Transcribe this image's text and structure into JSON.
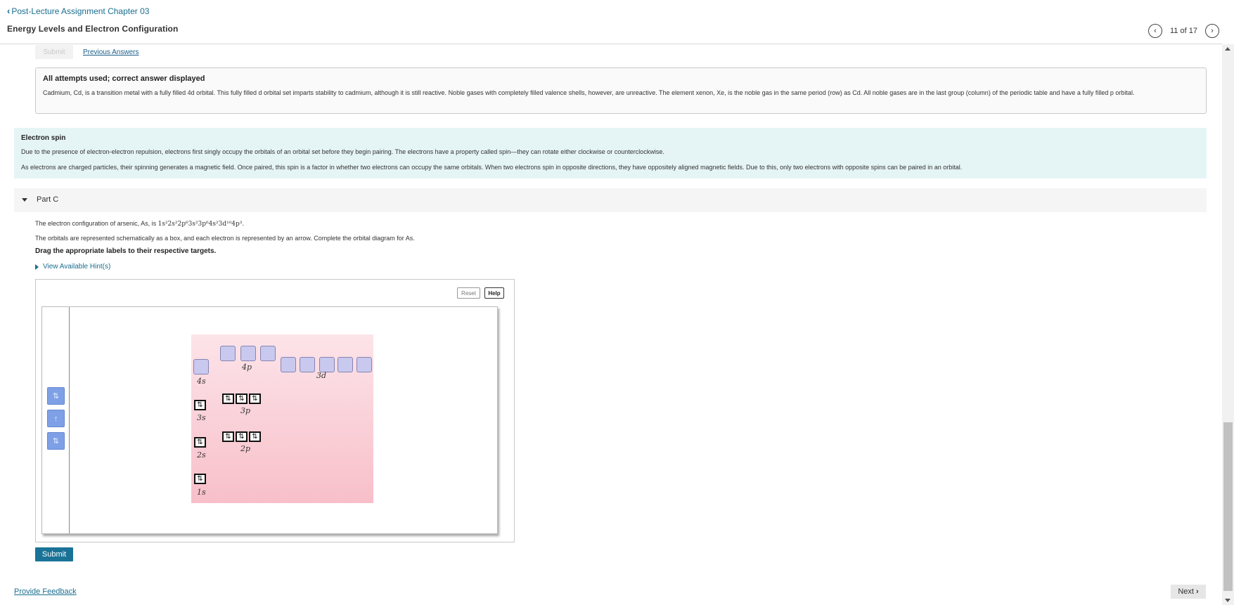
{
  "header": {
    "back_label": "Post-Lecture Assignment Chapter 03",
    "title": "Energy Levels and Electron Configuration",
    "pager": "11 of 17",
    "prev_glyph": "‹",
    "next_glyph": "›"
  },
  "previous_part": {
    "submit_label": "Submit",
    "previous_answers_label": "Previous Answers",
    "feedback_title": "All attempts used; correct answer displayed",
    "feedback_text": "Cadmium, Cd, is a transition metal with a fully filled 4d orbital. This fully filled d orbital set imparts stability to cadmium, although it is still reactive. Noble gases with completely filled valence shells, however, are unreactive. The element xenon, Xe, is the noble gas in the same period (row) as Cd. All noble gases are in the last group (column) of the periodic table and have a fully filled p orbital."
  },
  "electron_spin": {
    "title": "Electron spin",
    "paragraph1": "Due to the presence of electron-electron repulsion, electrons first singly occupy the orbitals of an orbital set before they begin pairing. The electrons have a property called spin—they can rotate either clockwise or counterclockwise.",
    "paragraph2": "As electrons are charged particles, their spinning generates a magnetic field. Once paired, this spin is a factor in whether two electrons can occupy the same orbitals. When two electrons spin in opposite directions, they have oppositely aligned magnetic fields. Due to this, only two electrons with opposite spins can be paired in an orbital."
  },
  "part_c": {
    "label": "Part C",
    "config_prefix": "The electron configuration of arsenic, As, is ",
    "config": "1s²2s²2p⁶3s²3p⁶4s²3d¹⁰4p³.",
    "orbitals_text": "The orbitals are represented schematically as a box, and each electron is represented by an arrow. Complete the orbital diagram for As.",
    "instruction": "Drag the appropriate labels to their respective targets.",
    "hint_label": "View Available Hint(s)",
    "reset_label": "Reset",
    "help_label": "Help",
    "palette": [
      "⇅",
      "↑",
      "⇅"
    ],
    "filled_symbol": "⇅",
    "labels": {
      "s4": "4s",
      "p4": "4p",
      "d3": "3d",
      "s3": "3s",
      "p3": "3p",
      "s2": "2s",
      "p2": "2p",
      "s1": "1s"
    },
    "submit_label": "Submit"
  },
  "footer": {
    "feedback_label": "Provide Feedback",
    "next_label": "Next"
  },
  "colors": {
    "link": "#1a6e8f",
    "submit": "#1a7396",
    "info_box": "#e5f4f5",
    "chip": "#7ea0e6",
    "target": "#c9c8ee"
  }
}
